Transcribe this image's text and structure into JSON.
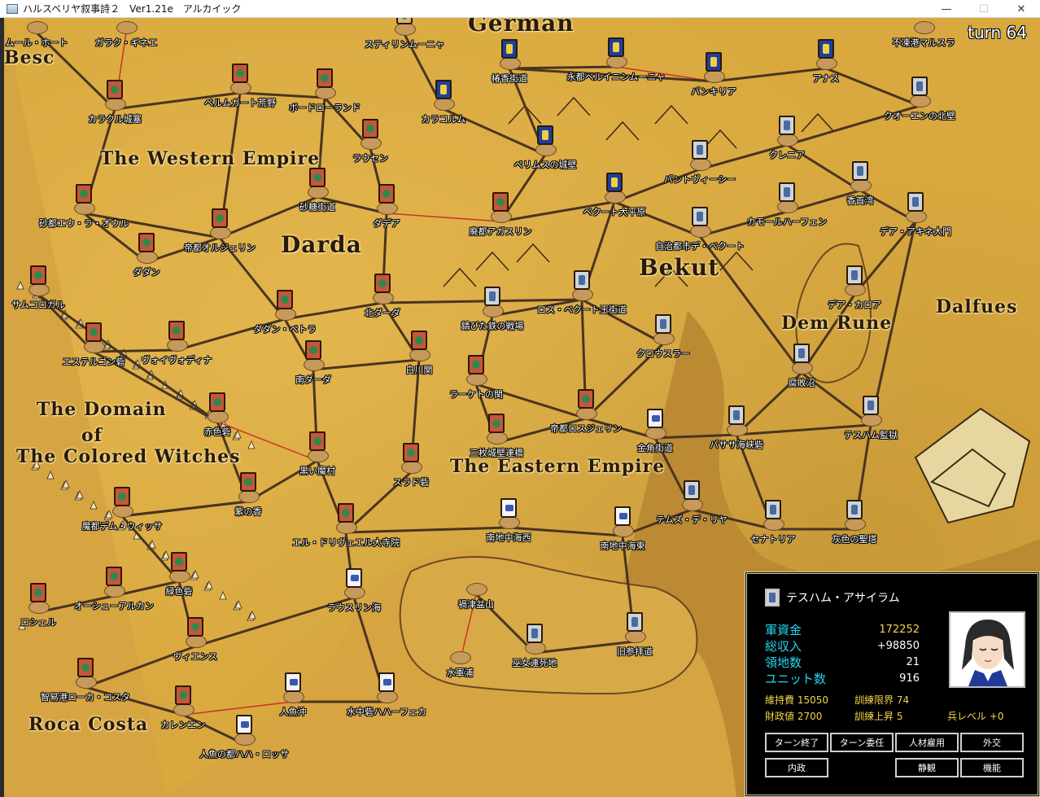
{
  "window": {
    "title": "ハルスベリヤ叙事詩２　Ver1.21e　アルカイック",
    "min": "—",
    "max": "☐",
    "close": "✕"
  },
  "turn_label": "turn 64",
  "regions": [
    {
      "name": "The Western Empire"
    },
    {
      "name": "Darda"
    },
    {
      "name": "Bekut"
    },
    {
      "name": "Dem Rune"
    },
    {
      "name": "Dalfues"
    },
    {
      "name": "The Domain"
    },
    {
      "name": "of"
    },
    {
      "name": "The Colored Witches"
    },
    {
      "name": "The Eastern Empire"
    },
    {
      "name": "Roca Costa"
    },
    {
      "name": "Besc"
    },
    {
      "name": "German"
    }
  ],
  "cities": [
    {
      "name": "ムール・ホート",
      "faction": "none"
    },
    {
      "name": "ガラク・ギネエ",
      "faction": "none"
    },
    {
      "name": "スティリンムーニャ",
      "faction": "tan"
    },
    {
      "name": "椿香街道",
      "faction": "blue"
    },
    {
      "name": "永都ベルイニンムーニャ",
      "faction": "blue"
    },
    {
      "name": "バンキリア",
      "faction": "blue"
    },
    {
      "name": "アナス",
      "faction": "blue"
    },
    {
      "name": "不凍港マルスラ",
      "faction": "none"
    },
    {
      "name": "カラクル城塞",
      "faction": "red"
    },
    {
      "name": "ペルムガート荒野",
      "faction": "red"
    },
    {
      "name": "ボードローランド",
      "faction": "red"
    },
    {
      "name": "カラコルム",
      "faction": "blue"
    },
    {
      "name": "ペリムスの城壁",
      "faction": "blue"
    },
    {
      "name": "クオーエンの北壁",
      "faction": "grey"
    },
    {
      "name": "ラウセン",
      "faction": "red"
    },
    {
      "name": "クレニア",
      "faction": "grey"
    },
    {
      "name": "パントヴィーシー",
      "faction": "grey"
    },
    {
      "name": "砂都エウ・ラ・オウル",
      "faction": "red"
    },
    {
      "name": "砂糖街道",
      "faction": "red"
    },
    {
      "name": "ダデア",
      "faction": "red"
    },
    {
      "name": "廃都アガスリン",
      "faction": "red"
    },
    {
      "name": "ベクート大平原",
      "faction": "blue"
    },
    {
      "name": "香首湾",
      "faction": "grey"
    },
    {
      "name": "カモールハーフェン",
      "faction": "grey"
    },
    {
      "name": "デア・アキネ大門",
      "faction": "grey"
    },
    {
      "name": "ダダン",
      "faction": "red"
    },
    {
      "name": "帝都オルジェリン",
      "faction": "red"
    },
    {
      "name": "自治都市デ・ベクート",
      "faction": "grey"
    },
    {
      "name": "サムコロガル",
      "faction": "red"
    },
    {
      "name": "デア・カロア",
      "faction": "grey"
    },
    {
      "name": "北ダーダ",
      "faction": "red"
    },
    {
      "name": "ロス・ベクート王街道",
      "faction": "grey"
    },
    {
      "name": "錆びた鉄の戦場",
      "faction": "grey"
    },
    {
      "name": "エステルゴン砦",
      "faction": "red"
    },
    {
      "name": "ダダン・ペトラ",
      "faction": "red"
    },
    {
      "name": "ヴォイヴォディナ",
      "faction": "red"
    },
    {
      "name": "白川関",
      "faction": "red"
    },
    {
      "name": "クロウスラー",
      "faction": "grey"
    },
    {
      "name": "南ダーダ",
      "faction": "red"
    },
    {
      "name": "腐敗沼",
      "faction": "grey"
    },
    {
      "name": "ラーケトの関",
      "faction": "red"
    },
    {
      "name": "帝都ロスジェリン",
      "faction": "red"
    },
    {
      "name": "赤色砦",
      "faction": "red"
    },
    {
      "name": "三枚城壁連橋",
      "faction": "red"
    },
    {
      "name": "金角街道",
      "faction": "white"
    },
    {
      "name": "パササ海峡砦",
      "faction": "grey"
    },
    {
      "name": "テスハム監獄",
      "faction": "grey"
    },
    {
      "name": "黒い魔村",
      "faction": "red"
    },
    {
      "name": "スラド砦",
      "faction": "red"
    },
    {
      "name": "紫の香",
      "faction": "red"
    },
    {
      "name": "魔都デム・ウィッサ",
      "faction": "red"
    },
    {
      "name": "エル・ドリヴェエル大寺院",
      "faction": "red"
    },
    {
      "name": "南地中海西",
      "faction": "white"
    },
    {
      "name": "テムズ・デ・リヤ",
      "faction": "grey"
    },
    {
      "name": "南地中海東",
      "faction": "white"
    },
    {
      "name": "セナトリア",
      "faction": "grey"
    },
    {
      "name": "灰色の聖塔",
      "faction": "grey"
    },
    {
      "name": "緑色砦",
      "faction": "red"
    },
    {
      "name": "オーシューアルカン",
      "faction": "red"
    },
    {
      "name": "ロシェル",
      "faction": "red"
    },
    {
      "name": "ラウスリン海",
      "faction": "white"
    },
    {
      "name": "禍津盆山",
      "faction": "none"
    },
    {
      "name": "ヴィエンス",
      "faction": "red"
    },
    {
      "name": "旧参拝道",
      "faction": "grey"
    },
    {
      "name": "水軍浦",
      "faction": "none"
    },
    {
      "name": "巫女連死地",
      "faction": "grey"
    },
    {
      "name": "智易港ローカ・コスタ",
      "faction": "red"
    },
    {
      "name": "人魚沖",
      "faction": "white"
    },
    {
      "name": "水中砦ハハーフェカ",
      "faction": "white"
    },
    {
      "name": "カレンエン",
      "faction": "red"
    },
    {
      "name": "人魚の都ハハ・ロッサ",
      "faction": "white"
    }
  ],
  "panel": {
    "name": "テスハム・アサイラム",
    "stats": [
      {
        "label": "軍資金",
        "value": "172252",
        "color": "gold"
      },
      {
        "label": "総収入",
        "value": "+98850",
        "color": "white"
      },
      {
        "label": "領地数",
        "value": "21",
        "color": "white"
      },
      {
        "label": "ユニット数",
        "value": "916",
        "color": "white"
      }
    ],
    "sub": {
      "upkeep": "維持費 15050",
      "train_limit": "訓練限界 74",
      "finance": "財政値 2700",
      "train_up": "訓練上昇 5",
      "soldier_level": "兵レベル +0"
    },
    "buttons": {
      "end_turn": "ターン終了",
      "delegate": "ターン委任",
      "hire": "人材雇用",
      "diplomacy": "外交",
      "domestic": "内政",
      "observe": "静観",
      "function": "機能"
    }
  }
}
